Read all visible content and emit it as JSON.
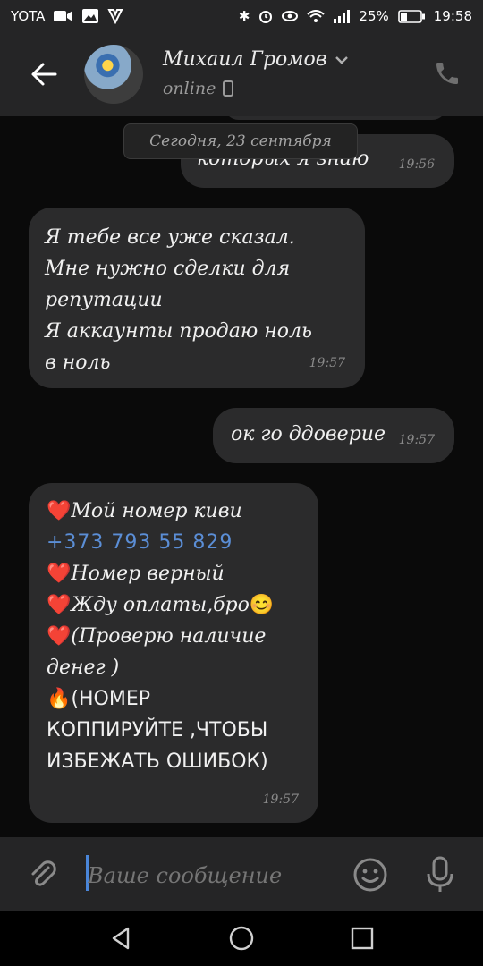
{
  "status_bar": {
    "carrier": "YOTA",
    "battery": "25%",
    "time": "19:58"
  },
  "header": {
    "contact_name": "Михаил Громов",
    "status": "online"
  },
  "chat": {
    "date_separator": "Сегодня, 23 сентября",
    "messages": [
      {
        "direction": "out",
        "text": "которых я знаю",
        "time": "19:56"
      },
      {
        "direction": "in",
        "lines": [
          "Я тебе все уже сказал.",
          "Мне нужно сделки для",
          "репутации",
          "Я аккаунты продаю ноль",
          "в ноль"
        ],
        "time": "19:57"
      },
      {
        "direction": "out",
        "text": "ок го ддоверие",
        "time": "19:57"
      },
      {
        "direction": "in",
        "time": "19:57",
        "line1": "Мой номер киви",
        "phone": "+373 793 55 829",
        "line3": "Номер верный",
        "line4": "Жду оплаты,бро",
        "line5a": "(Проверю наличие",
        "line5b": "денег )",
        "line6a": "(НОМЕР",
        "line6b": "КОППИРУЙТЕ ,ЧТОБЫ",
        "line6c": "ИЗБЕЖАТЬ ОШИБОК)"
      }
    ]
  },
  "composer": {
    "placeholder": "Ваше сообщение"
  },
  "colors": {
    "background": "#0a0a0a",
    "bubble": "#2b2b2c",
    "bar": "#252526",
    "link": "#5b8ed6",
    "accent": "#4a86d9"
  }
}
